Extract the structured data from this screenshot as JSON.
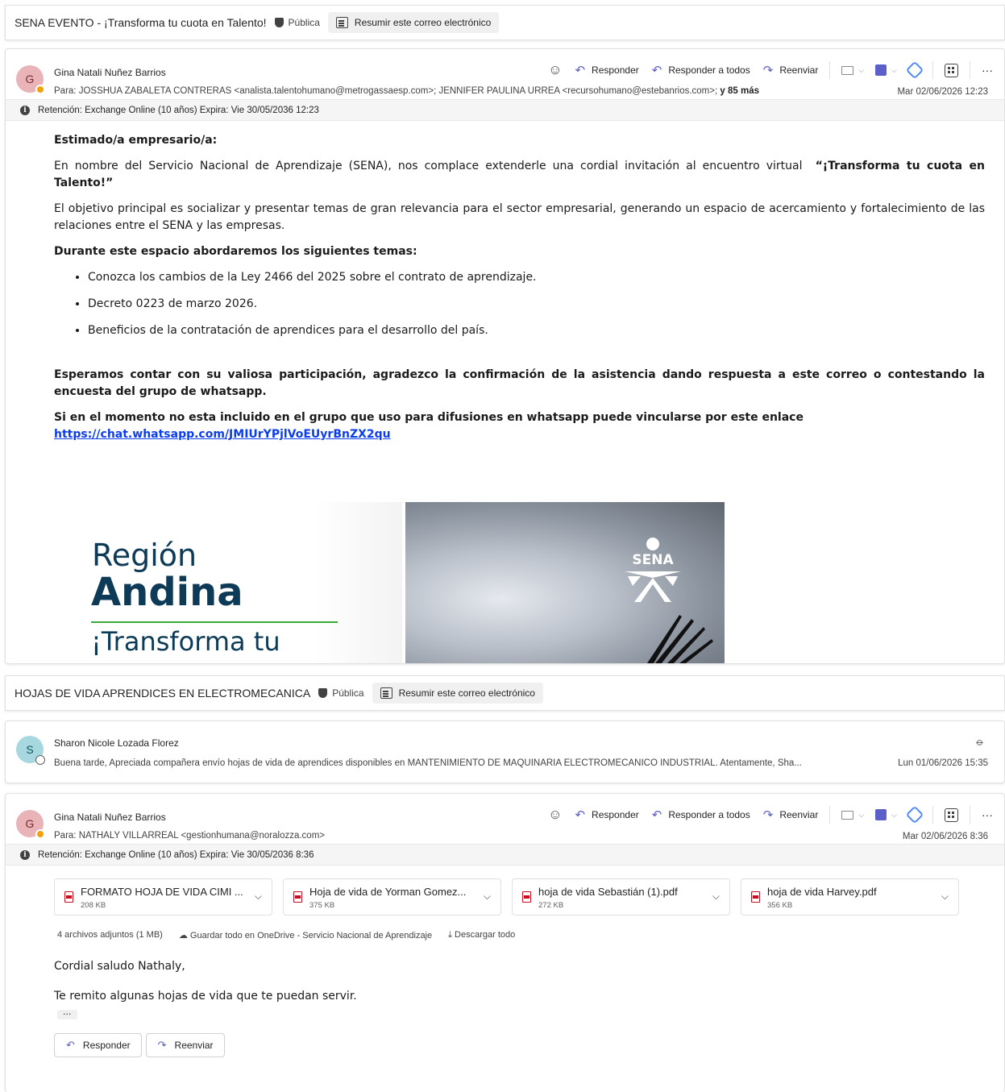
{
  "email1": {
    "subject": "SENA EVENTO - ¡Transforma tu cuota en Talento!",
    "badge": "Pública",
    "summarize": "Resumir este correo electrónico",
    "avatar_letter": "G",
    "sender": "Gina Natali Nuñez Barrios",
    "to_prefix": "Para:",
    "to_recipients": "JOSSHUA ZABALETA CONTRERAS <analista.talentohumano@metrogassaesp.com>;   JENNIFER PAULINA URREA <recursohumano@estebanrios.com>;",
    "to_more": "y 85 más",
    "date": "Mar 02/06/2026 12:23",
    "retention": "Retención: Exchange Online (10 años) Expira: Vie 30/05/2036 12:23",
    "body": {
      "greeting": "Estimado/a empresario/a:",
      "p1_start": "En nombre del Servicio Nacional de Aprendizaje (SENA), nos complace extenderle una cordial invitación al encuentro virtual",
      "p1_bold": "“¡Transforma tu cuota en Talento!”",
      "p2": "El objetivo principal es socializar y presentar temas de gran relevancia para el sector empresarial, generando un espacio de acercamiento y fortalecimiento de las relaciones entre el SENA y las empresas.",
      "topics_heading": "Durante este espacio abordaremos los siguientes temas:",
      "topics": [
        "Conozca los cambios de la Ley 2466 del 2025 sobre el contrato de aprendizaje.",
        "Decreto 0223 de marzo 2026.",
        "Beneficios de la contratación de aprendices para el desarrollo del país."
      ],
      "closing": "Esperamos contar con su valiosa participación, agradezco la confirmación de la asistencia dando respuesta a este correo o contestando la encuesta del grupo de whatsapp.",
      "link_intro": "Si en el momento no esta incluido en el grupo que uso para difusiones en whatsapp puede vincularse por este enlace",
      "link": "https://chat.whatsapp.com/JMIUrYPjlVoEUyrBnZX2qu"
    },
    "banner": {
      "region": "Región",
      "andina": "Andina",
      "transforma": "¡Transforma tu",
      "logo_text": "SENA"
    }
  },
  "actions": {
    "reply": "Responder",
    "reply_all": "Responder a todos",
    "forward": "Reenviar"
  },
  "email2": {
    "subject": "HOJAS DE VIDA APRENDICES EN ELECTROMECANICA",
    "badge": "Pública",
    "summarize": "Resumir este correo electrónico",
    "collapsed": {
      "avatar_letter": "S",
      "sender": "Sharon Nicole Lozada Florez",
      "preview": "Buena tarde, Apreciada compañera envío hojas de vida de aprendices disponibles en MANTENIMIENTO DE MAQUINARIA ELECTROMECANICO INDUSTRIAL. Atentamente, Sha...",
      "date": "Lun 01/06/2026 15:35"
    },
    "message": {
      "avatar_letter": "G",
      "sender": "Gina Natali Nuñez Barrios",
      "to_prefix": "Para:",
      "to_recipients": "NATHALY VILLARREAL <gestionhumana@noralozza.com>",
      "date": "Mar 02/06/2026 8:36",
      "retention": "Retención: Exchange Online (10 años) Expira: Vie 30/05/2036 8:36",
      "attachments": [
        {
          "name": "FORMATO HOJA DE VIDA CIMI ...",
          "size": "208 KB"
        },
        {
          "name": "Hoja de vida de Yorman Gomez...",
          "size": "375 KB"
        },
        {
          "name": "hoja de vida Sebastián (1).pdf",
          "size": "272 KB"
        },
        {
          "name": "hoja de vida Harvey.pdf",
          "size": "356 KB"
        }
      ],
      "attachments_summary": "4 archivos adjuntos (1 MB)",
      "save_onedrive": "Guardar todo en OneDrive - Servicio Nacional de Aprendizaje",
      "download_all": "Descargar todo",
      "greeting": "Cordial saludo Nathaly,",
      "line": "Te remito algunas hojas de vida que te puedan servir.",
      "ellipsis": "···",
      "reply_button": "Responder",
      "forward_button": "Reenviar"
    }
  },
  "colors": {
    "accent": "#5b5fc7",
    "avatar_g": "#e8b4b8",
    "avatar_s": "#a7d8e0",
    "link": "#0b3df0",
    "banner_navy": "#0d3a56",
    "banner_green": "#39a935"
  }
}
